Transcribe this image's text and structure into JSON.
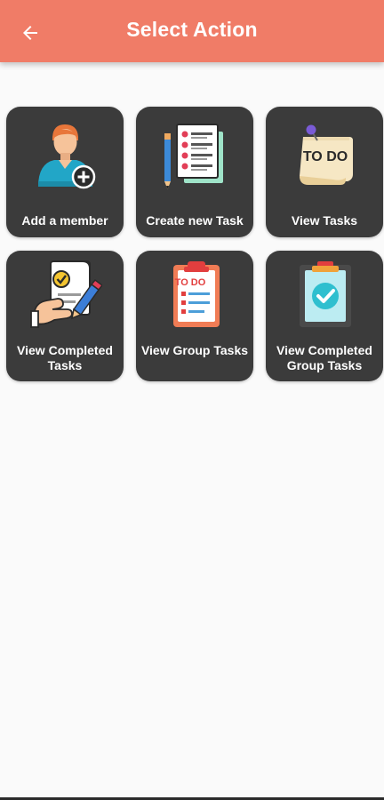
{
  "header": {
    "title": "Select Action",
    "back_icon": "arrow-left-icon",
    "background": "#f07c67"
  },
  "tiles": [
    {
      "label": "Add a member",
      "icon": "add-user-icon"
    },
    {
      "label": "Create new Task",
      "icon": "task-checklist-icon"
    },
    {
      "label": "View Tasks",
      "icon": "todo-note-icon"
    },
    {
      "label": "View Completed Tasks",
      "icon": "completed-check-hand-icon"
    },
    {
      "label": "View Group Tasks",
      "icon": "group-todo-clipboard-icon"
    },
    {
      "label": "View Completed Group Tasks",
      "icon": "completed-clipboard-icon"
    }
  ],
  "colors": {
    "tile_background": "#3b3b3b",
    "page_background": "#fafafa"
  }
}
